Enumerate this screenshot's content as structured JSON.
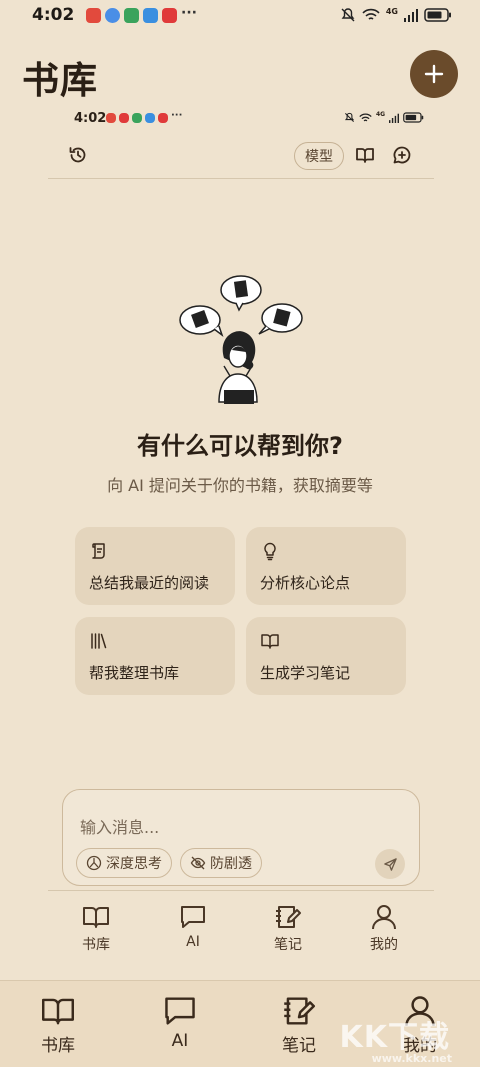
{
  "status_bar": {
    "time": "4:02",
    "network": "4G",
    "app_icons": [
      "#e24a3d",
      "#4a8ee6",
      "#3aa35c",
      "#3a8fe0",
      "#e03a3a"
    ]
  },
  "inner_status_bar": {
    "time": "4:02",
    "network": "4G"
  },
  "header": {
    "title": "书库"
  },
  "toolbar": {
    "model_label": "模型"
  },
  "hero": {
    "headline": "有什么可以帮到你?",
    "subline": "向 AI 提问关于你的书籍，获取摘要等"
  },
  "suggestions": [
    {
      "label": "总结我最近的阅读",
      "icon": "scroll-icon"
    },
    {
      "label": "分析核心论点",
      "icon": "lightbulb-icon"
    },
    {
      "label": "帮我整理书库",
      "icon": "library-icon"
    },
    {
      "label": "生成学习笔记",
      "icon": "book-open-icon"
    }
  ],
  "composer": {
    "placeholder": "输入消息...",
    "chip_deep_think": "深度思考",
    "chip_no_spoiler": "防剧透"
  },
  "inner_nav": [
    {
      "label": "书库",
      "icon": "book-icon"
    },
    {
      "label": "AI",
      "icon": "chat-icon"
    },
    {
      "label": "笔记",
      "icon": "notebook-icon"
    },
    {
      "label": "我的",
      "icon": "person-icon"
    }
  ],
  "bottom_nav": [
    {
      "label": "书库",
      "icon": "book-icon"
    },
    {
      "label": "AI",
      "icon": "chat-icon"
    },
    {
      "label": "笔记",
      "icon": "notebook-icon"
    },
    {
      "label": "我的",
      "icon": "person-icon"
    }
  ],
  "watermark": {
    "brand": "KK下载",
    "url": "www.kkx.net"
  },
  "colors": {
    "background": "#efe3cf",
    "accent": "#6a4b2b",
    "card": "#e4d5bd"
  }
}
